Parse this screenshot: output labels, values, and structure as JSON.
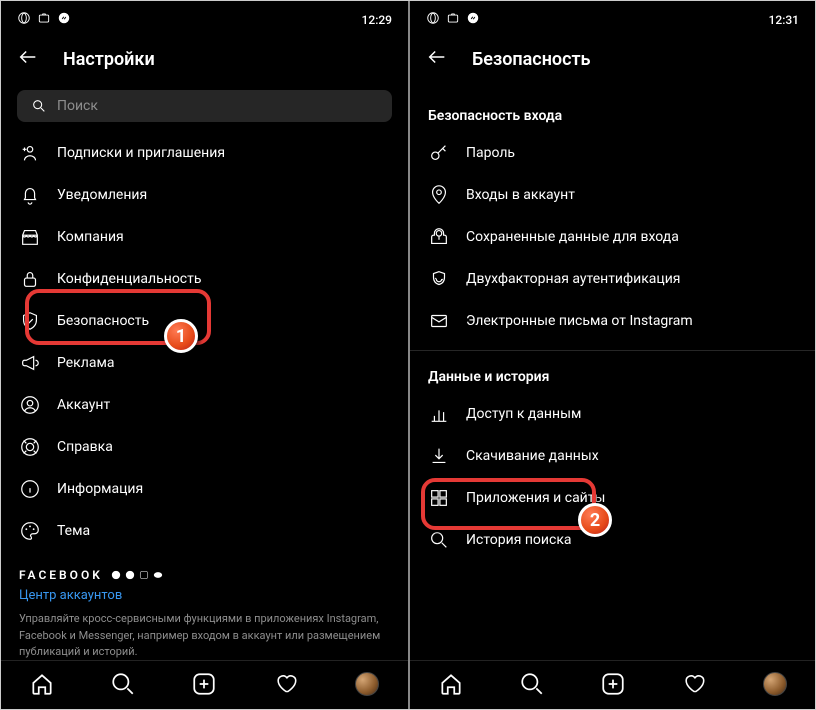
{
  "left": {
    "time": "12:29",
    "title": "Настройки",
    "search_placeholder": "Поиск",
    "items": [
      "Подписки и приглашения",
      "Уведомления",
      "Компания",
      "Конфиденциальность",
      "Безопасность",
      "Реклама",
      "Аккаунт",
      "Справка",
      "Информация",
      "Тема"
    ],
    "brand": "FACEBOOK",
    "accounts_center": "Центр аккаунтов",
    "description": "Управляйте кросс-сервисными функциями в приложениях Instagram, Facebook и Messenger, например входом в аккаунт или размещением публикаций и историй."
  },
  "right": {
    "time": "12:31",
    "title": "Безопасность",
    "section1_title": "Безопасность входа",
    "section1_items": [
      "Пароль",
      "Входы в аккаунт",
      "Сохраненные данные для входа",
      "Двухфакторная аутентификация",
      "Электронные письма от Instagram"
    ],
    "section2_title": "Данные и история",
    "section2_items": [
      "Доступ к данным",
      "Скачивание данных",
      "Приложения и сайты",
      "История поиска"
    ]
  },
  "badges": {
    "one": "1",
    "two": "2"
  }
}
